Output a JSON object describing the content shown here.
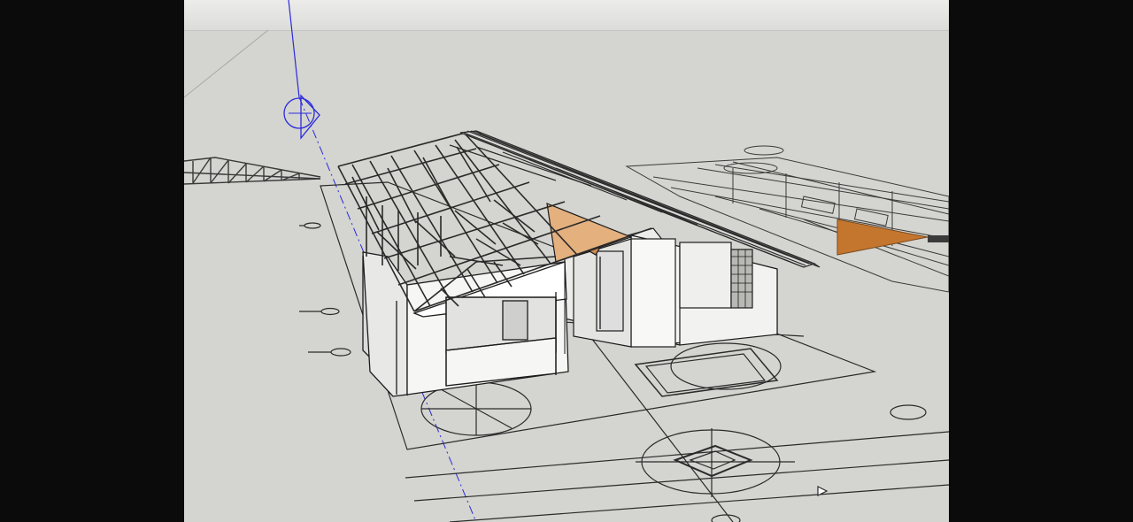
{
  "app": {
    "viewport_label": "",
    "colors": {
      "ground": "#d4d4d0",
      "sky": "#e6e6e4",
      "letterbox": "#0b0b0b",
      "axis_blue": "#2b2bdc",
      "wall_white": "#f6f6f4",
      "wall_shade": "#dcdcdc",
      "roof_accent": "#c4762f",
      "line": "#1c1c1c"
    },
    "icons": {
      "section_plane_marker": "section-plane-icon",
      "axis": "blue-axis-icon"
    }
  }
}
